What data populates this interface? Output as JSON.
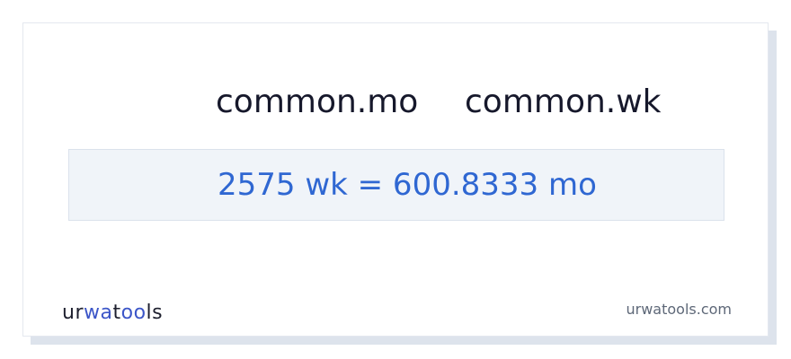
{
  "conversion": {
    "from_unit": "common.mo",
    "to_unit": "common.wk",
    "result": "2575 wk = 600.8333 mo"
  },
  "footer": {
    "logo_parts": {
      "p1": "ur",
      "p2": "wa",
      "p3": "t",
      "p4": "oo",
      "p5": "ls"
    },
    "site_url": "urwatools.com"
  },
  "colors": {
    "accent": "#2f67d2",
    "logo_accent": "#3c56c8",
    "text_dark": "#16182b",
    "result_bg": "#f0f4f9"
  }
}
